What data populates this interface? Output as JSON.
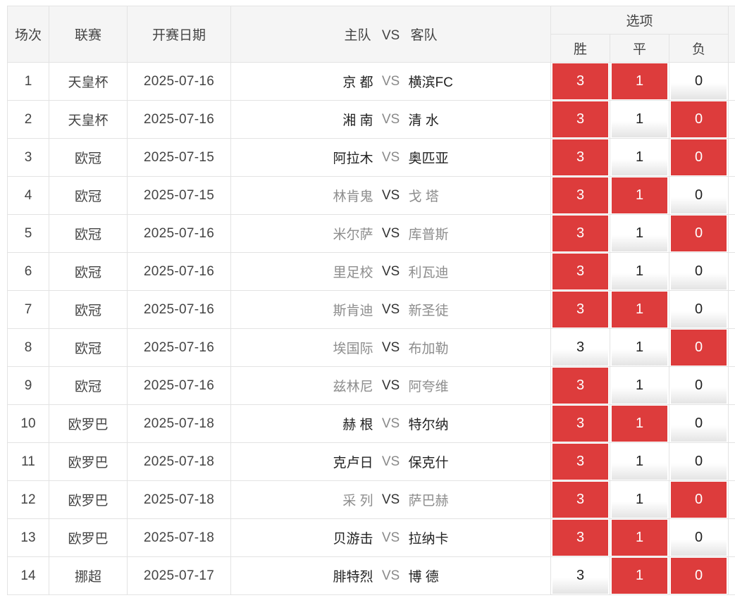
{
  "header": {
    "col_index": "场次",
    "col_league": "联赛",
    "col_date": "开赛日期",
    "col_home": "主队",
    "col_vs": "VS",
    "col_away": "客队",
    "col_options": "选项",
    "opt_win": "胜",
    "opt_draw": "平",
    "opt_loss": "负"
  },
  "colors": {
    "selected": "#dd3c3c",
    "header_bg": "#f5f5f5",
    "border": "#e3e3e3"
  },
  "rows": [
    {
      "idx": "1",
      "league": "天皇杯",
      "date": "2025-07-16",
      "home": "京 都",
      "vs": "VS",
      "away": "横滨FC",
      "team_style": "dark",
      "vs_style": "gray",
      "win": "3",
      "draw": "1",
      "loss": "0",
      "sel": [
        true,
        true,
        false
      ]
    },
    {
      "idx": "2",
      "league": "天皇杯",
      "date": "2025-07-16",
      "home": "湘 南",
      "vs": "VS",
      "away": "清 水",
      "team_style": "dark",
      "vs_style": "gray",
      "win": "3",
      "draw": "1",
      "loss": "0",
      "sel": [
        true,
        false,
        true
      ]
    },
    {
      "idx": "3",
      "league": "欧冠",
      "date": "2025-07-15",
      "home": "阿拉木",
      "vs": "VS",
      "away": "奥匹亚",
      "team_style": "dark",
      "vs_style": "gray",
      "win": "3",
      "draw": "1",
      "loss": "0",
      "sel": [
        true,
        false,
        true
      ]
    },
    {
      "idx": "4",
      "league": "欧冠",
      "date": "2025-07-15",
      "home": "林肯鬼",
      "vs": "VS",
      "away": "戈 塔",
      "team_style": "gray",
      "vs_style": "dark",
      "win": "3",
      "draw": "1",
      "loss": "0",
      "sel": [
        true,
        true,
        false
      ]
    },
    {
      "idx": "5",
      "league": "欧冠",
      "date": "2025-07-16",
      "home": "米尔萨",
      "vs": "VS",
      "away": "库普斯",
      "team_style": "gray",
      "vs_style": "dark",
      "win": "3",
      "draw": "1",
      "loss": "0",
      "sel": [
        true,
        false,
        true
      ]
    },
    {
      "idx": "6",
      "league": "欧冠",
      "date": "2025-07-16",
      "home": "里足校",
      "vs": "VS",
      "away": "利瓦迪",
      "team_style": "gray",
      "vs_style": "dark",
      "win": "3",
      "draw": "1",
      "loss": "0",
      "sel": [
        true,
        false,
        false
      ]
    },
    {
      "idx": "7",
      "league": "欧冠",
      "date": "2025-07-16",
      "home": "斯肯迪",
      "vs": "VS",
      "away": "新圣徒",
      "team_style": "gray",
      "vs_style": "dark",
      "win": "3",
      "draw": "1",
      "loss": "0",
      "sel": [
        true,
        true,
        false
      ]
    },
    {
      "idx": "8",
      "league": "欧冠",
      "date": "2025-07-16",
      "home": "埃国际",
      "vs": "VS",
      "away": "布加勒",
      "team_style": "gray",
      "vs_style": "dark",
      "win": "3",
      "draw": "1",
      "loss": "0",
      "sel": [
        false,
        false,
        true
      ]
    },
    {
      "idx": "9",
      "league": "欧冠",
      "date": "2025-07-16",
      "home": "兹林尼",
      "vs": "VS",
      "away": "阿夸维",
      "team_style": "gray",
      "vs_style": "dark",
      "win": "3",
      "draw": "1",
      "loss": "0",
      "sel": [
        true,
        false,
        false
      ]
    },
    {
      "idx": "10",
      "league": "欧罗巴",
      "date": "2025-07-18",
      "home": "赫 根",
      "vs": "VS",
      "away": "特尔纳",
      "team_style": "dark",
      "vs_style": "gray",
      "win": "3",
      "draw": "1",
      "loss": "0",
      "sel": [
        true,
        true,
        false
      ]
    },
    {
      "idx": "11",
      "league": "欧罗巴",
      "date": "2025-07-18",
      "home": "克卢日",
      "vs": "VS",
      "away": "保克什",
      "team_style": "dark",
      "vs_style": "gray",
      "win": "3",
      "draw": "1",
      "loss": "0",
      "sel": [
        true,
        false,
        false
      ]
    },
    {
      "idx": "12",
      "league": "欧罗巴",
      "date": "2025-07-18",
      "home": "采 列",
      "vs": "VS",
      "away": "萨巴赫",
      "team_style": "gray",
      "vs_style": "dark",
      "win": "3",
      "draw": "1",
      "loss": "0",
      "sel": [
        true,
        false,
        true
      ]
    },
    {
      "idx": "13",
      "league": "欧罗巴",
      "date": "2025-07-18",
      "home": "贝游击",
      "vs": "VS",
      "away": "拉纳卡",
      "team_style": "dark",
      "vs_style": "gray",
      "win": "3",
      "draw": "1",
      "loss": "0",
      "sel": [
        true,
        true,
        false
      ]
    },
    {
      "idx": "14",
      "league": "挪超",
      "date": "2025-07-17",
      "home": "腓特烈",
      "vs": "VS",
      "away": "博 德",
      "team_style": "dark",
      "vs_style": "gray",
      "win": "3",
      "draw": "1",
      "loss": "0",
      "sel": [
        false,
        true,
        true
      ]
    }
  ]
}
